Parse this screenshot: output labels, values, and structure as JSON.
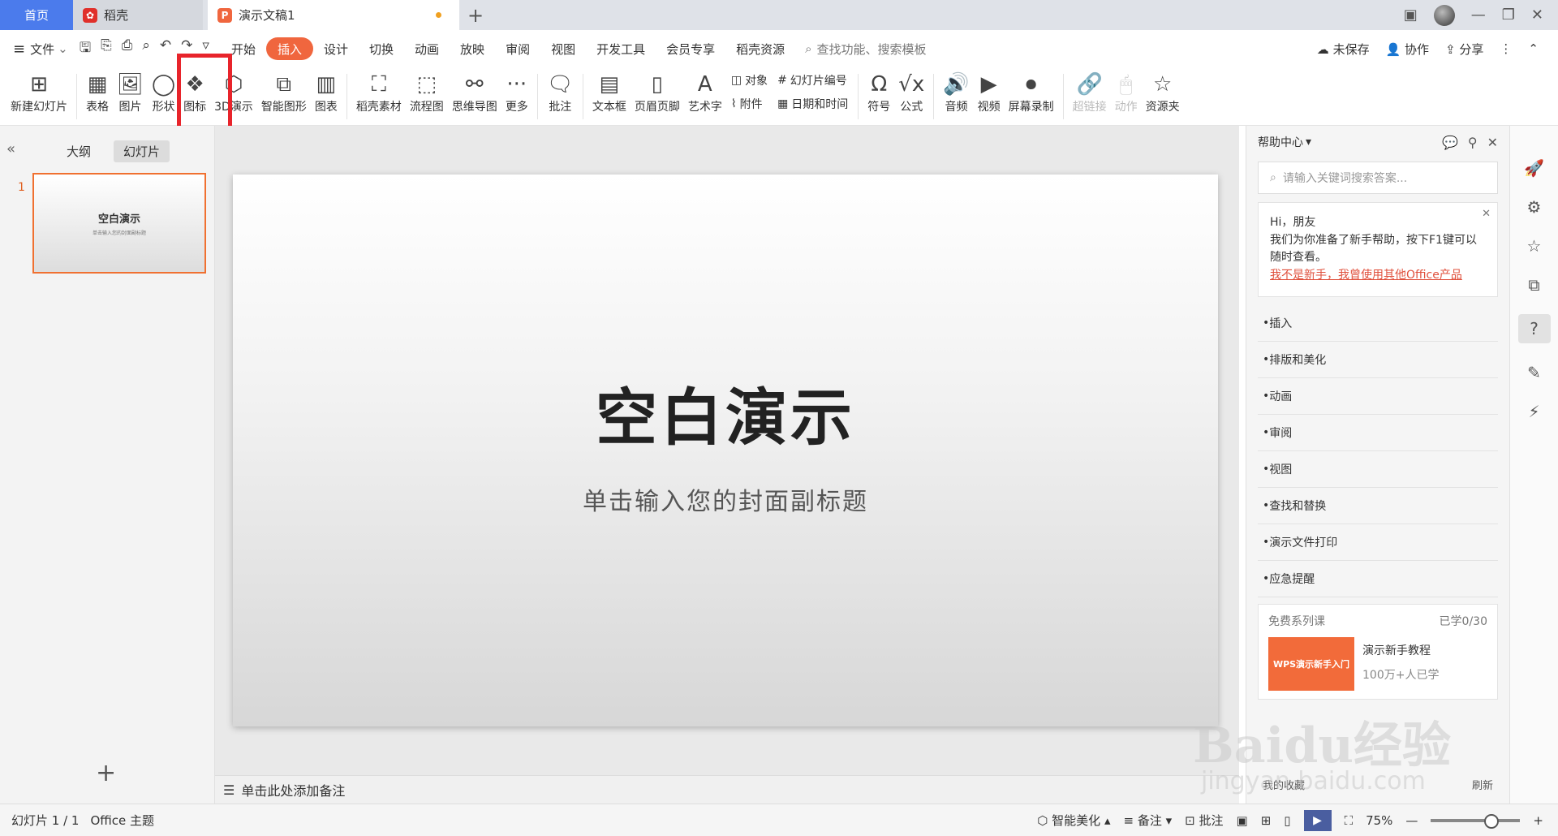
{
  "tabs": {
    "home": "首页",
    "daoke": "稻壳",
    "doc": "演示文稿1"
  },
  "menu": {
    "file": "文件",
    "items": [
      "开始",
      "插入",
      "设计",
      "切换",
      "动画",
      "放映",
      "审阅",
      "视图",
      "开发工具",
      "会员专享",
      "稻壳资源"
    ],
    "search_placeholder": "查找功能、搜索模板",
    "unsaved": "未保存",
    "collab": "协作",
    "share": "分享"
  },
  "ribbon": {
    "new_slide": "新建幻灯片",
    "table": "表格",
    "picture": "图片",
    "shape": "形状",
    "icon": "图标",
    "threed": "3D演示",
    "smartart": "智能图形",
    "chart": "图表",
    "daoke_material": "稻壳素材",
    "flowchart": "流程图",
    "mindmap": "思维导图",
    "more": "更多",
    "comment": "批注",
    "textbox": "文本框",
    "header_footer": "页眉页脚",
    "wordart": "艺术字",
    "object": "对象",
    "attachment": "附件",
    "slide_number": "幻灯片编号",
    "datetime": "日期和时间",
    "symbol": "符号",
    "formula": "公式",
    "audio": "音频",
    "video": "视频",
    "screen_record": "屏幕录制",
    "hyperlink": "超链接",
    "action": "动作",
    "resource": "资源夹"
  },
  "left_panel": {
    "outline": "大纲",
    "slides": "幻灯片",
    "slide_index": "1",
    "thumb_title": "空白演示",
    "thumb_sub": "单击输入您的封面副标题"
  },
  "slide": {
    "title": "空白演示",
    "subtitle": "单击输入您的封面副标题"
  },
  "notes": "单击此处添加备注",
  "help": {
    "title": "帮助中心",
    "search_placeholder": "请输入关键词搜索答案...",
    "greet": "Hi，朋友",
    "greet_text": "我们为你准备了新手帮助，按下F1键可以随时查看。",
    "link": "我不是新手，我曾使用其他Office产品",
    "items": [
      "插入",
      "排版和美化",
      "动画",
      "审阅",
      "视图",
      "查找和替换",
      "演示文件打印",
      "应急提醒"
    ],
    "course_head": "免费系列课",
    "course_progress": "已学0/30",
    "course_cover": "WPS演示新手入门",
    "course_title": "演示新手教程",
    "course_count": "100万+人已学",
    "foot_left": "我的收藏",
    "foot_right": "刷新"
  },
  "status": {
    "slide_info": "幻灯片 1 / 1",
    "theme": "Office 主题",
    "beautify": "智能美化",
    "notes": "备注",
    "comment": "批注",
    "zoom": "75%"
  },
  "watermark": {
    "main": "Baidu经验",
    "sub": "jingyan.baidu.com"
  },
  "colors": {
    "accent": "#f0663e",
    "home_tab": "#4b7bec",
    "highlight": "#e8242b"
  }
}
